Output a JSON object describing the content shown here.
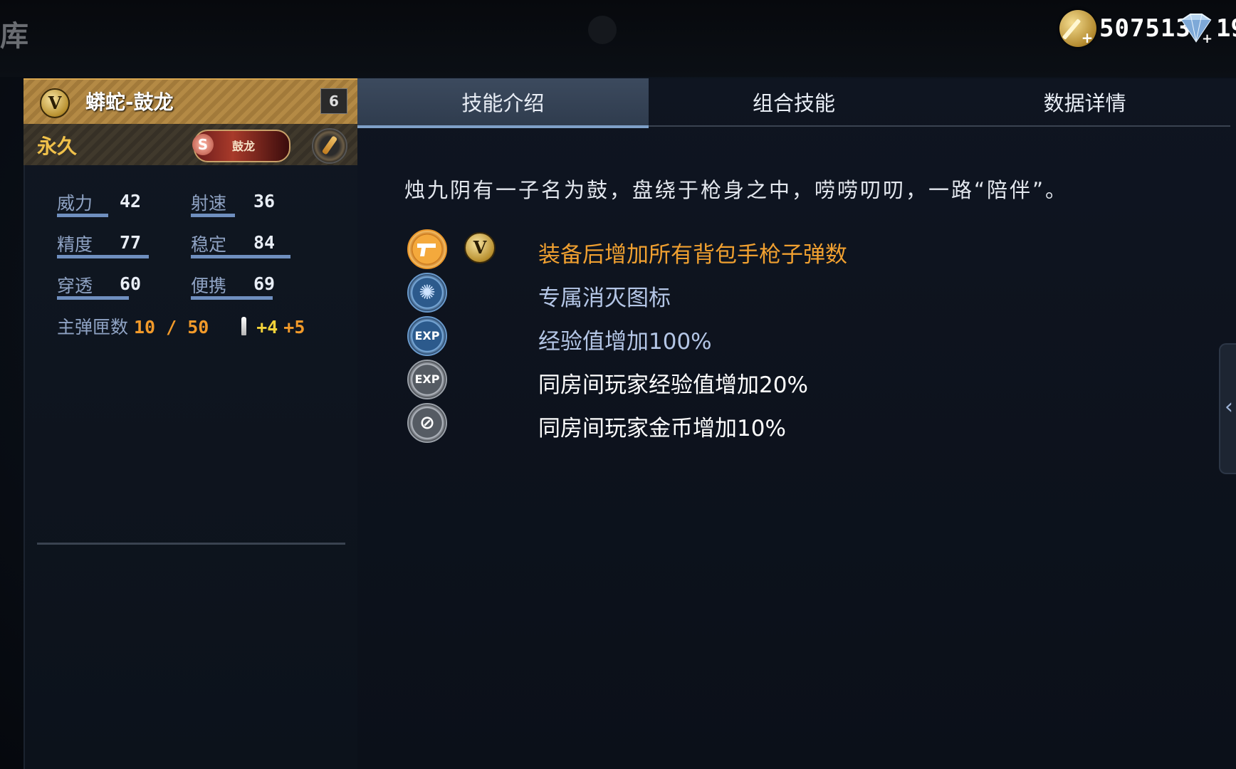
{
  "topbar": {
    "left_char": "库",
    "gold_amount": "507513",
    "diamond_amount": "19"
  },
  "weapon": {
    "name": "蟒蛇-鼓龙",
    "level": "6",
    "duration": "永久",
    "skin_badge_label": "鼓龙",
    "skin_badge_icon": "S"
  },
  "stats": [
    {
      "label": "威力",
      "value": "42"
    },
    {
      "label": "射速",
      "value": "36"
    },
    {
      "label": "精度",
      "value": "77"
    },
    {
      "label": "稳定",
      "value": "84"
    },
    {
      "label": "穿透",
      "value": "60"
    },
    {
      "label": "便携",
      "value": "69"
    }
  ],
  "ammo": {
    "label": "主弹匣数",
    "value": "10 / 50",
    "bonus1": "+4",
    "bonus2": "+5"
  },
  "tabs": [
    {
      "label": "技能介绍",
      "active": true
    },
    {
      "label": "组合技能",
      "active": false
    },
    {
      "label": "数据详情",
      "active": false
    }
  ],
  "description": "烛九阴有一子名为鼓，盘绕于枪身之中，唠唠叨叨，一路“陪伴”。",
  "skills": [
    {
      "text": "装备后增加所有背包手枪子弹数",
      "color": "#f0a030",
      "icon": "pistol-icon"
    },
    {
      "text": "专属消灭图标",
      "color": "#b4c6e6",
      "icon": "kill-mark-icon"
    },
    {
      "text": "经验值增加100%",
      "color": "#b4c6e6",
      "icon": "exp-icon"
    },
    {
      "text": "同房间玩家经验值增加20%",
      "color": "#ffffff",
      "icon": "room-exp-icon"
    },
    {
      "text": "同房间玩家金币增加10%",
      "color": "#ffffff",
      "icon": "room-gold-icon"
    }
  ],
  "colors": {
    "accent_gold": "#f0c14a",
    "accent_orange": "#f29a2a",
    "stat_bar": "#6f8fbf",
    "tab_active": "#3c4a5e"
  }
}
